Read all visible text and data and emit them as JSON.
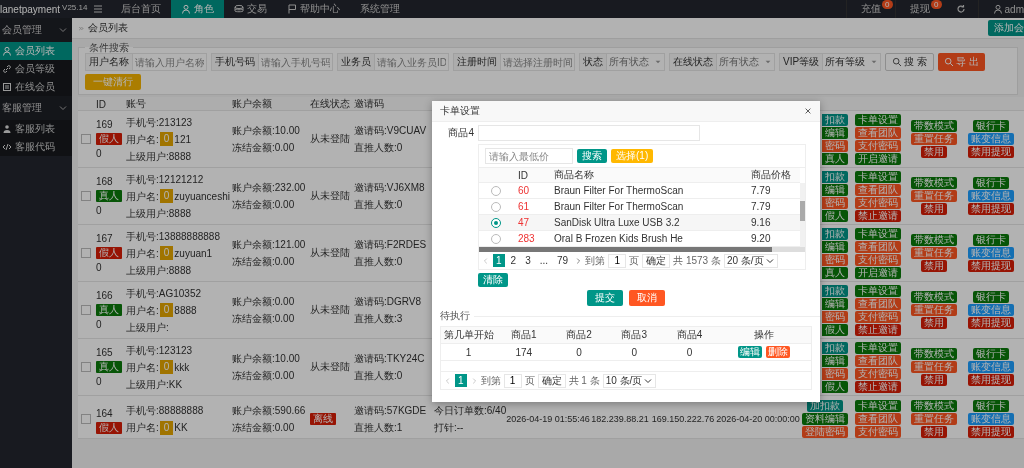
{
  "topbar": {
    "logo": "lanetpayment",
    "version": "V25.14",
    "menu": [
      {
        "label": "后台首页",
        "selected": false
      },
      {
        "label": "角色",
        "selected": true
      },
      {
        "label": "交易",
        "selected": false
      },
      {
        "label": "帮助中心",
        "selected": false
      },
      {
        "label": "系统管理",
        "selected": false
      }
    ],
    "links": [
      {
        "label": "充值",
        "badge": "0"
      },
      {
        "label": "提现",
        "badge": "0"
      }
    ],
    "user": "adm"
  },
  "sidebar": [
    {
      "label": "会员管理",
      "expanded": true,
      "children": [
        {
          "label": "会员列表",
          "selected": true
        },
        {
          "label": "会员等级",
          "selected": false
        },
        {
          "label": "在线会员",
          "selected": false
        }
      ]
    },
    {
      "label": "客服管理",
      "expanded": true,
      "children": [
        {
          "label": "客服列表",
          "selected": false
        },
        {
          "label": "客服代码",
          "selected": false
        }
      ]
    }
  ],
  "breadcrumb": "会员列表",
  "add_button": "添加会",
  "search": {
    "legend": "条件搜索",
    "fields": [
      {
        "kind": "text",
        "label": "用户名称",
        "placeholder": "请输入用户名称"
      },
      {
        "kind": "text",
        "label": "手机号码",
        "placeholder": "请输入手机号码"
      },
      {
        "kind": "text",
        "label": "业务员",
        "placeholder": "请输入业务员ID"
      },
      {
        "kind": "text",
        "label": "注册时间",
        "placeholder": "请选择注册时间"
      },
      {
        "kind": "select",
        "label": "状态",
        "placeholder": "所有状态"
      },
      {
        "kind": "select",
        "label": "在线状态",
        "placeholder": "所有状态"
      },
      {
        "kind": "select",
        "label": "VIP等级",
        "value": "所有等级"
      }
    ],
    "search_button": "搜 索",
    "export_button": "导 出",
    "bulk_button": "一键清行"
  },
  "table": {
    "columns": [
      "ID",
      "账号",
      "账户余额",
      "在线状态",
      "邀请码"
    ],
    "rows": [
      {
        "checked": false,
        "id": "169",
        "tag": {
          "text": "假人",
          "kind": "fake"
        },
        "sub": "0",
        "phone": "手机号:213123",
        "user_label": "用户名:",
        "user_badge": "0",
        "user_rest": "121",
        "parent": "上级用户:8888",
        "balance": "账户余额:10.00",
        "frozen": "冻结金额:0.00",
        "online": {
          "kind": "text",
          "text": "从未登陆"
        },
        "invite": "邀请码:V9CUAV",
        "direct": "直推人数:0",
        "actions": [
          [
            {
              "text": "扣款",
              "kind": "primary"
            },
            {
              "text": "编辑",
              "kind": "ok"
            },
            {
              "text": "密码",
              "kind": "warn"
            },
            {
              "text": "真人",
              "kind": "ok"
            }
          ],
          [
            {
              "text": "卡单设置",
              "kind": "ok"
            },
            {
              "text": "查看团队",
              "kind": "warn"
            },
            {
              "text": "支付密码",
              "kind": "warn"
            },
            {
              "text": "开启邀请",
              "kind": "ok"
            }
          ],
          [
            {
              "text": "带数模式",
              "kind": "ok"
            },
            {
              "text": "重置任务",
              "kind": "warn"
            },
            {
              "text": "禁用",
              "kind": "danger"
            }
          ],
          [
            {
              "text": "银行卡",
              "kind": "ok"
            },
            {
              "text": "账变信息",
              "kind": "info"
            },
            {
              "text": "禁用提现",
              "kind": "danger"
            }
          ]
        ]
      },
      {
        "checked": false,
        "id": "168",
        "tag": {
          "text": "真人",
          "kind": "real"
        },
        "sub": "0",
        "phone": "手机号:12121212",
        "user_label": "用户名:",
        "user_badge": "0",
        "user_rest": "zuyuanceshi",
        "parent": "上级用户:8888",
        "balance": "账户余额:232.00",
        "frozen": "冻结金额:0.00",
        "online": {
          "kind": "text",
          "text": "从未登陆"
        },
        "invite": "邀请码:VJ6XM8",
        "direct": "直推人数:0",
        "actions": [
          [
            {
              "text": "扣款",
              "kind": "primary"
            },
            {
              "text": "编辑",
              "kind": "ok"
            },
            {
              "text": "密码",
              "kind": "warn"
            },
            {
              "text": "假人",
              "kind": "ok"
            }
          ],
          [
            {
              "text": "卡单设置",
              "kind": "ok"
            },
            {
              "text": "查看团队",
              "kind": "warn"
            },
            {
              "text": "支付密码",
              "kind": "warn"
            },
            {
              "text": "禁止邀请",
              "kind": "danger"
            }
          ],
          [
            {
              "text": "带数模式",
              "kind": "ok"
            },
            {
              "text": "重置任务",
              "kind": "warn"
            },
            {
              "text": "禁用",
              "kind": "danger"
            }
          ],
          [
            {
              "text": "银行卡",
              "kind": "ok"
            },
            {
              "text": "账变信息",
              "kind": "info"
            },
            {
              "text": "禁用提现",
              "kind": "danger"
            }
          ]
        ]
      },
      {
        "checked": false,
        "id": "167",
        "tag": {
          "text": "假人",
          "kind": "fake"
        },
        "sub": "0",
        "phone": "手机号:13888888888",
        "user_label": "用户名:",
        "user_badge": "0",
        "user_rest": "zuyuan1",
        "parent": "上级用户:8888",
        "balance": "账户余额:121.00",
        "frozen": "冻结金额:0.00",
        "online": {
          "kind": "text",
          "text": "从未登陆"
        },
        "invite": "邀请码:F2RDES",
        "direct": "直推人数:0",
        "actions": [
          [
            {
              "text": "扣款",
              "kind": "primary"
            },
            {
              "text": "编辑",
              "kind": "ok"
            },
            {
              "text": "密码",
              "kind": "warn"
            },
            {
              "text": "真人",
              "kind": "ok"
            }
          ],
          [
            {
              "text": "卡单设置",
              "kind": "ok"
            },
            {
              "text": "查看团队",
              "kind": "warn"
            },
            {
              "text": "支付密码",
              "kind": "warn"
            },
            {
              "text": "开启邀请",
              "kind": "ok"
            }
          ],
          [
            {
              "text": "带数模式",
              "kind": "ok"
            },
            {
              "text": "重置任务",
              "kind": "warn"
            },
            {
              "text": "禁用",
              "kind": "danger"
            }
          ],
          [
            {
              "text": "银行卡",
              "kind": "ok"
            },
            {
              "text": "账变信息",
              "kind": "info"
            },
            {
              "text": "禁用提现",
              "kind": "danger"
            }
          ]
        ]
      },
      {
        "checked": false,
        "id": "166",
        "tag": {
          "text": "真人",
          "kind": "real"
        },
        "sub": "0",
        "phone": "手机号:AG10352",
        "user_label": "用户名:",
        "user_badge": "0",
        "user_rest": "8888",
        "parent": "上级用户:",
        "balance": "账户余额:0.00",
        "frozen": "冻结金额:0.00",
        "online": {
          "kind": "text",
          "text": "从未登陆"
        },
        "invite": "邀请码:DGRV8",
        "direct": "直推人数:3",
        "actions": [
          [
            {
              "text": "扣款",
              "kind": "primary"
            },
            {
              "text": "编辑",
              "kind": "ok"
            },
            {
              "text": "密码",
              "kind": "warn"
            },
            {
              "text": "假人",
              "kind": "ok"
            }
          ],
          [
            {
              "text": "卡单设置",
              "kind": "ok"
            },
            {
              "text": "查看团队",
              "kind": "warn"
            },
            {
              "text": "支付密码",
              "kind": "warn"
            },
            {
              "text": "禁止邀请",
              "kind": "danger"
            }
          ],
          [
            {
              "text": "带数模式",
              "kind": "ok"
            },
            {
              "text": "重置任务",
              "kind": "warn"
            },
            {
              "text": "禁用",
              "kind": "danger"
            }
          ],
          [
            {
              "text": "银行卡",
              "kind": "ok"
            },
            {
              "text": "账变信息",
              "kind": "info"
            },
            {
              "text": "禁用提现",
              "kind": "danger"
            }
          ]
        ]
      },
      {
        "checked": false,
        "id": "165",
        "tag": {
          "text": "真人",
          "kind": "real"
        },
        "sub": "0",
        "phone": "手机号:123123",
        "user_label": "用户名:",
        "user_badge": "0",
        "user_rest": "kkk",
        "parent": "上级用户:KK",
        "balance": "账户余额:10.00",
        "frozen": "冻结金额:0.00",
        "online": {
          "kind": "text",
          "text": "从未登陆"
        },
        "invite": "邀请码:TKY24C",
        "direct": "直推人数:0",
        "actions": [
          [
            {
              "text": "扣款",
              "kind": "primary"
            },
            {
              "text": "编辑",
              "kind": "ok"
            },
            {
              "text": "密码",
              "kind": "warn"
            },
            {
              "text": "假人",
              "kind": "ok"
            }
          ],
          [
            {
              "text": "卡单设置",
              "kind": "ok"
            },
            {
              "text": "查看团队",
              "kind": "warn"
            },
            {
              "text": "支付密码",
              "kind": "warn"
            },
            {
              "text": "禁止邀请",
              "kind": "danger"
            }
          ],
          [
            {
              "text": "带数模式",
              "kind": "ok"
            },
            {
              "text": "重置任务",
              "kind": "warn"
            },
            {
              "text": "禁用",
              "kind": "danger"
            }
          ],
          [
            {
              "text": "银行卡",
              "kind": "ok"
            },
            {
              "text": "账变信息",
              "kind": "info"
            },
            {
              "text": "禁用提现",
              "kind": "danger"
            }
          ]
        ]
      },
      {
        "checked": false,
        "id": "164",
        "tag": {
          "text": "假人",
          "kind": "fake"
        },
        "phone": "手机号:88888888",
        "user_label": "用户名:",
        "user_badge": "0",
        "user_rest": "KK",
        "balance": "账户余额:590.66",
        "frozen": "冻结金额:0.00",
        "online": {
          "kind": "badge",
          "text": "离线"
        },
        "invite": "邀请码:57KGDE",
        "direct": "直推人数:1",
        "column_6": [
          "今日订单数:6/40",
          "打针:--"
        ],
        "column_7": "2026-04-19 01:55:46",
        "column_8": "182.239.88.21",
        "column_9": "169.150.222.76",
        "column_10": "2026-04-20 00:00:00",
        "actions": [
          [
            {
              "text": "加扣款",
              "kind": "primary"
            },
            {
              "text": "资料编辑",
              "kind": "ok"
            },
            {
              "text": "登陆密码",
              "kind": "warn"
            }
          ],
          [
            {
              "text": "卡单设置",
              "kind": "ok"
            },
            {
              "text": "查看团队",
              "kind": "warn"
            },
            {
              "text": "支付密码",
              "kind": "warn"
            }
          ],
          [
            {
              "text": "带数模式",
              "kind": "ok"
            },
            {
              "text": "重置任务",
              "kind": "warn"
            },
            {
              "text": "禁用",
              "kind": "danger"
            }
          ],
          [
            {
              "text": "银行卡",
              "kind": "ok"
            },
            {
              "text": "账变信息",
              "kind": "info"
            },
            {
              "text": "禁用提现",
              "kind": "danger"
            }
          ]
        ]
      }
    ]
  },
  "modal": {
    "title": "卡单设置",
    "field_label": "商品4",
    "picker": {
      "placeholder": "请输入最低价",
      "search_button": "搜索",
      "choose_button": "选择(1)",
      "columns": [
        "ID",
        "商品名称",
        "商品价格"
      ],
      "rows": [
        {
          "id": "60",
          "name": "Braun Filter For ThermoScan",
          "price": "7.79",
          "selected": false
        },
        {
          "id": "61",
          "name": "Braun Filter For ThermoScan",
          "price": "7.79",
          "selected": false
        },
        {
          "id": "47",
          "name": "SanDisk Ultra Luxe USB 3.2",
          "price": "9.16",
          "selected": true
        },
        {
          "id": "283",
          "name": "Oral B Frozen Kids Brush He",
          "price": "9.20",
          "selected": false
        }
      ],
      "pager": {
        "pages": [
          {
            "label": "1",
            "selected": true
          },
          {
            "label": "2",
            "selected": false
          },
          {
            "label": "3",
            "selected": false
          },
          {
            "label": "...",
            "selected": false
          },
          {
            "label": "79",
            "selected": false
          }
        ],
        "goto": "到第",
        "page_value": "1",
        "page_unit": "页",
        "confirm": "确定",
        "total": "共 1573 条",
        "size": "20 条/页"
      }
    },
    "clear_button": "清除",
    "submit_button": "提交",
    "cancel_button": "取消",
    "pending": {
      "legend": "待执行",
      "columns": [
        "第几单开始",
        "商品1",
        "商品2",
        "商品3",
        "商品4",
        "操作"
      ],
      "rows": [
        {
          "cells": [
            "1",
            "174",
            "0",
            "0",
            "0"
          ],
          "actions": [
            {
              "text": "编辑",
              "kind": "primary"
            },
            {
              "text": "删除",
              "kind": "warn"
            }
          ]
        }
      ],
      "pager": {
        "pages": [
          {
            "label": "1",
            "selected": true
          }
        ],
        "goto": "到第",
        "page_value": "1",
        "page_unit": "页",
        "confirm": "确定",
        "total": "共 1 条",
        "size": "10 条/页"
      }
    }
  }
}
